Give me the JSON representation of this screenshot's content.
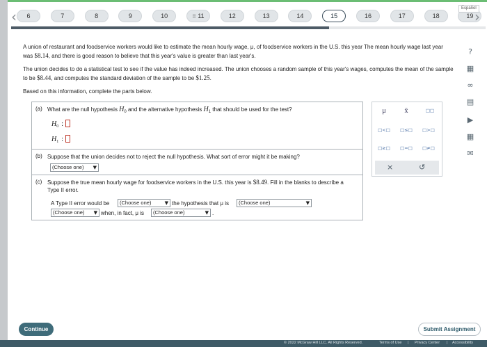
{
  "nav": {
    "prev_glyph": "‹",
    "next_glyph": "›",
    "questions": [
      {
        "label": "6",
        "state": "normal"
      },
      {
        "label": "7",
        "state": "normal"
      },
      {
        "label": "8",
        "state": "normal"
      },
      {
        "label": "9",
        "state": "normal"
      },
      {
        "label": "10",
        "state": "normal"
      },
      {
        "label": "= 11",
        "state": "partial"
      },
      {
        "label": "12",
        "state": "normal"
      },
      {
        "label": "13",
        "state": "normal"
      },
      {
        "label": "14",
        "state": "normal"
      },
      {
        "label": "15",
        "state": "active"
      },
      {
        "label": "16",
        "state": "normal"
      },
      {
        "label": "17",
        "state": "normal"
      },
      {
        "label": "18",
        "state": "normal"
      },
      {
        "label": "19",
        "state": "normal"
      }
    ],
    "language_link": "Español",
    "progress_fraction": 0.67
  },
  "side_tools": {
    "help_icon": "?",
    "calculator_icon": "▦",
    "link_icon": "∞",
    "notes_icon": "▤",
    "video_icon": "▶",
    "table_icon": "▦",
    "message_icon": "✉"
  },
  "problem": {
    "para1_a": "A union of restaurant and foodservice workers would like to estimate the mean hourly wage, μ, of foodservice workers in the U.S. this year The mean hourly wage last year was ",
    "para1_val": "$8.14",
    "para1_b": ", and there is good reason to believe that this year's value is greater than last year's.",
    "para2_a": "The union decides to do a statistical test to see if the value has indeed increased. The union chooses a random sample of this year's wages, computes the mean of the sample to be ",
    "para2_val1": "$8.44",
    "para2_b": ", and computes the standard deviation of the sample to be ",
    "para2_val2": "$1.25",
    "para2_c": ".",
    "para3": "Based on this information, complete the parts below."
  },
  "part_a": {
    "label": "(a)",
    "text_a": "What are the null hypothesis ",
    "h0": "H",
    "h0_sub": "0",
    "text_b": " and the alternative hypothesis ",
    "h1": "H",
    "h1_sub": "1",
    "text_c": " that should be used for the test?",
    "colon": ":"
  },
  "part_b": {
    "label": "(b)",
    "text": "Suppose that the union decides not to reject the null hypothesis. What sort of error might it be making?",
    "dropdown": "(Choose one)"
  },
  "part_c": {
    "label": "(c)",
    "text_a": "Suppose the true mean hourly wage for foodservice workers in the U.S. this year is ",
    "text_val": "$8.49",
    "text_b": ". Fill in the blanks to describe a Type II error.",
    "line1_a": "A Type II error would be",
    "dropdown1": "(Choose one)",
    "line1_b": "the hypothesis that μ is",
    "dropdown2": "(Choose one)",
    "dropdown3": "(Choose one)",
    "line2_a": "when, in fact, μ is",
    "dropdown4": "(Choose one)",
    "period": "."
  },
  "palette": {
    "mu": "μ",
    "xbar": "x̄",
    "power": "□□",
    "lt": "□<□",
    "le": "□≤□",
    "gt": "□>□",
    "ge": "□≥□",
    "eq": "□=□",
    "ne": "□≠□",
    "clear": "×",
    "undo": "↺"
  },
  "bottom": {
    "continue": "Continue",
    "submit": "Submit Assignment",
    "copyright": "© 2022 McGraw Hill LLC. All Rights Reserved.",
    "terms": "Terms of Use",
    "privacy": "Privacy Center",
    "accessibility": "Accessibility",
    "sep": "|"
  }
}
